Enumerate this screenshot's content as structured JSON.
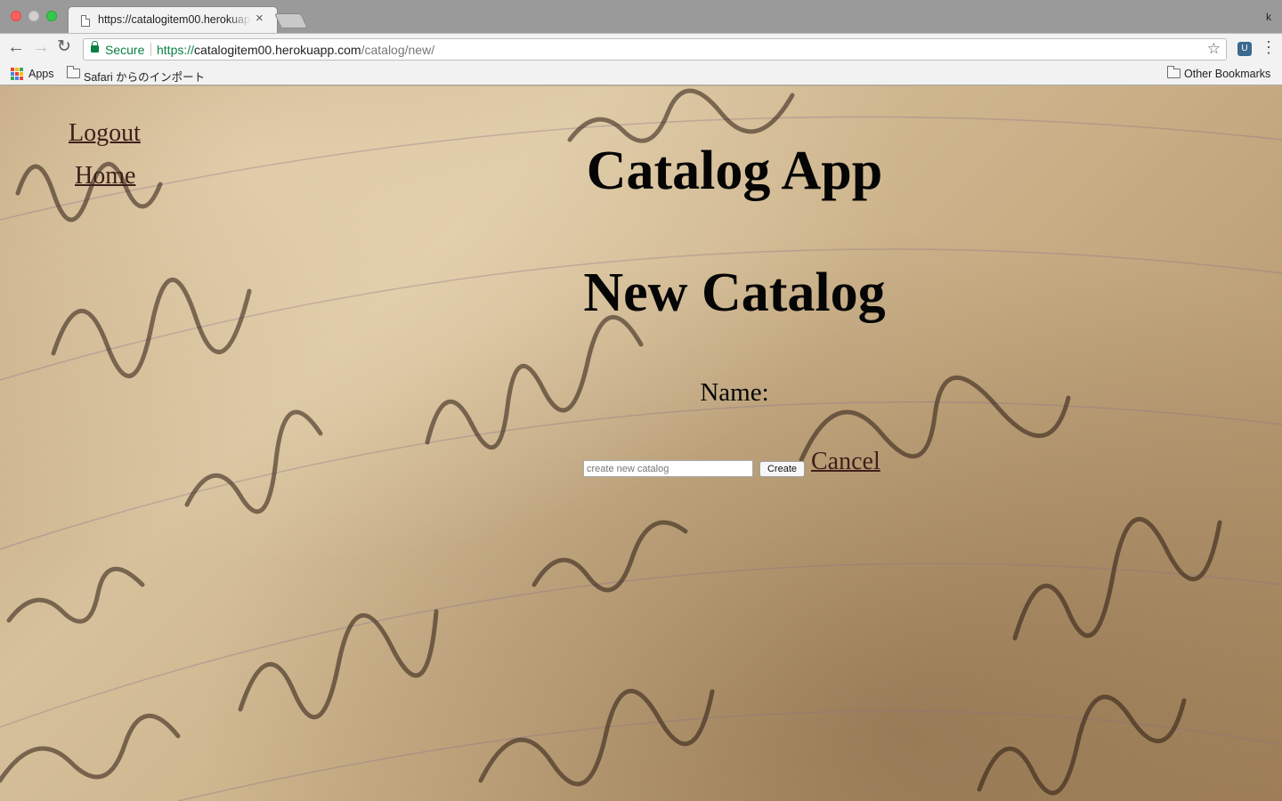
{
  "browser": {
    "tab_title": "https://catalogitem00.herokuapp.com/catalog/new/",
    "tab_close": "×",
    "profile_initial": "k",
    "secure_label": "Secure",
    "url_scheme": "https://",
    "url_host": "catalogitem00.herokuapp.com",
    "url_path": "/catalog/new/",
    "icons": {
      "back": "back-arrow-icon",
      "forward": "forward-arrow-icon",
      "reload": "reload-icon",
      "lock": "lock-icon",
      "star": "star-icon",
      "extension": "extension-icon",
      "menu": "more-menu-icon"
    },
    "bookmarks": {
      "apps_label": "Apps",
      "safari_import_label": "Safari からのインポート",
      "other_label": "Other Bookmarks"
    }
  },
  "page": {
    "nav": {
      "logout_label": "Logout",
      "home_label": "Home"
    },
    "app_title": "Catalog App",
    "page_title": "New Catalog",
    "form": {
      "name_label": "Name:",
      "name_value": "",
      "name_placeholder": "create new catalog",
      "create_label": "Create",
      "cancel_label": "Cancel"
    },
    "colors": {
      "link": "#3d1f1a",
      "heading": "#050505",
      "secure_green": "#0b8043"
    }
  }
}
